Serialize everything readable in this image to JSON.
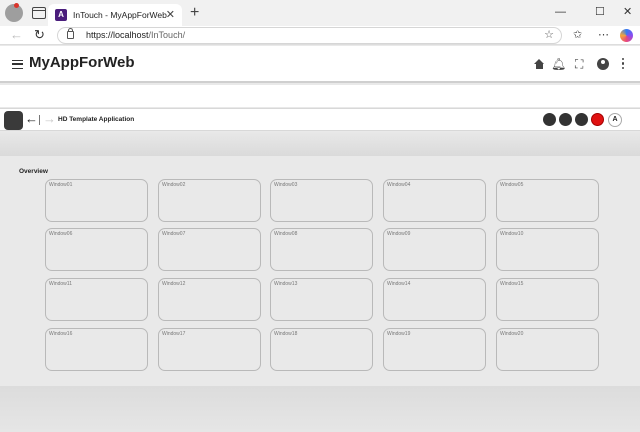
{
  "browser": {
    "tab_title": "InTouch - MyAppForWeb",
    "favicon_letter": "A",
    "close_tab_glyph": "✕",
    "new_tab_glyph": "+",
    "url_base": "https://localhost",
    "url_path": "/InTouch/",
    "icons": [
      "profile-icon",
      "tab-actions-icon",
      "back-icon",
      "refresh-icon",
      "lock-icon",
      "favorite-star-icon",
      "favorites-icon",
      "more-icon",
      "copilot-icon",
      "minimize-icon",
      "maximize-icon",
      "close-icon"
    ]
  },
  "app_header": {
    "title": "MyAppForWeb",
    "icons": [
      "menu-icon",
      "home-icon",
      "bell-icon",
      "fullscreen-icon",
      "account-icon",
      "kebab-icon"
    ]
  },
  "template_bar": {
    "title": "HD Template Application",
    "letter_button": "A",
    "dot_buttons": [
      {
        "color": "#333333"
      },
      {
        "color": "#333333"
      },
      {
        "color": "#333333"
      },
      {
        "color": "#e01212"
      }
    ]
  },
  "overview": {
    "title": "Overview",
    "windows": [
      "Window01",
      "Window02",
      "Window03",
      "Window04",
      "Window05",
      "Window06",
      "Window07",
      "Window08",
      "Window09",
      "Window10",
      "Window11",
      "Window12",
      "Window13",
      "Window14",
      "Window15",
      "Window16",
      "Window17",
      "Window18",
      "Window19",
      "Window20"
    ]
  },
  "colors": {
    "accent_purple": "#4a1d7c",
    "alarm_red": "#e01212",
    "tile_border": "#b9b9b9"
  }
}
